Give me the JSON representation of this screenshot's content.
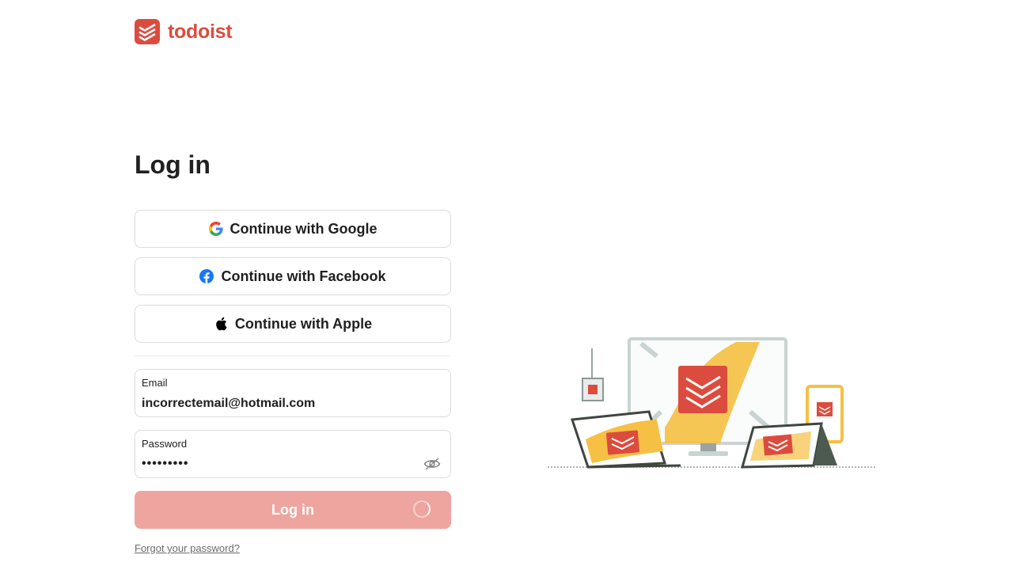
{
  "brand": {
    "name": "todoist",
    "color": "#dc4c3e"
  },
  "heading": "Log in",
  "social": {
    "google": {
      "label": "Continue with Google",
      "icon": "google-icon"
    },
    "facebook": {
      "label": "Continue with Facebook",
      "icon": "facebook-icon"
    },
    "apple": {
      "label": "Continue with Apple",
      "icon": "apple-icon"
    }
  },
  "email": {
    "label": "Email",
    "value": "incorrectemail@hotmail.com"
  },
  "password": {
    "label": "Password",
    "value": "•••••••••",
    "toggle_icon": "eye-off-icon"
  },
  "submit": {
    "label": "Log in",
    "state": "loading"
  },
  "forgot_link": "Forgot your password?",
  "colors": {
    "submit_bg": "#eea59f",
    "accent": "#dc4c3e",
    "text": "#202020"
  }
}
